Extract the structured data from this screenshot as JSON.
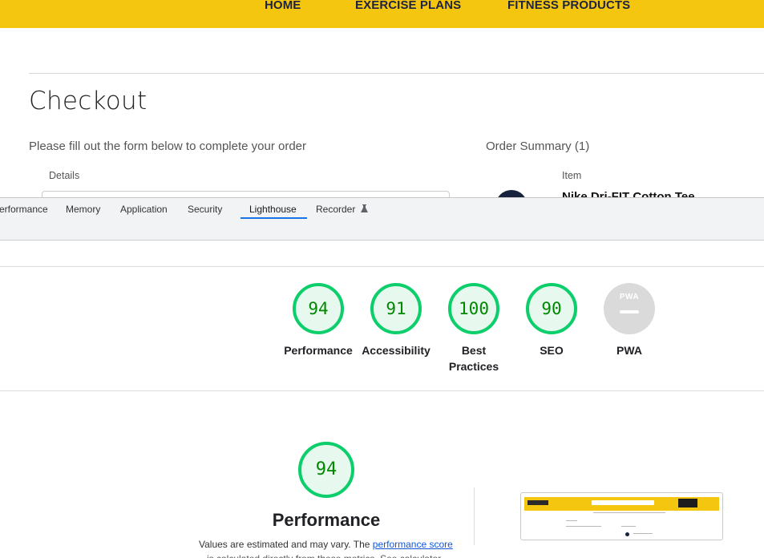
{
  "site": {
    "nav": [
      "HOME",
      "EXERCISE PLANS",
      "FITNESS PRODUCTS"
    ],
    "title": "Checkout",
    "form_intro": "Please fill out the form below to complete your order",
    "order_summary": "Order Summary (1)",
    "details_label": "Details",
    "item_label": "Item",
    "product_name": "Nike Dri-FIT Cotton Tee"
  },
  "colors": {
    "brand_yellow": "#f5c60f",
    "score_green": "#0cce6b",
    "score_text": "#008800",
    "link_blue": "#1558d6",
    "active_tab": "#1a73e8"
  },
  "devtools": {
    "tabs": [
      "erformance",
      "Memory",
      "Application",
      "Security",
      "Lighthouse",
      "Recorder"
    ],
    "active_tab": "Lighthouse",
    "recorder_icon": "flask-icon"
  },
  "lighthouse": {
    "categories": [
      {
        "label": "Performance",
        "score": 94
      },
      {
        "label": "Accessibility",
        "score": 91
      },
      {
        "label": "Best Practices",
        "label_line1": "Best",
        "label_line2": "Practices",
        "score": 100
      },
      {
        "label": "SEO",
        "score": 90
      },
      {
        "label": "PWA",
        "badge": "PWA"
      }
    ],
    "detail": {
      "score": 94,
      "title": "Performance",
      "disclaimer_pre": "Values are estimated and may vary. The ",
      "disclaimer_link": "performance score",
      "disclaimer_post": " is calculated directly from these metrics. See calculator."
    }
  }
}
